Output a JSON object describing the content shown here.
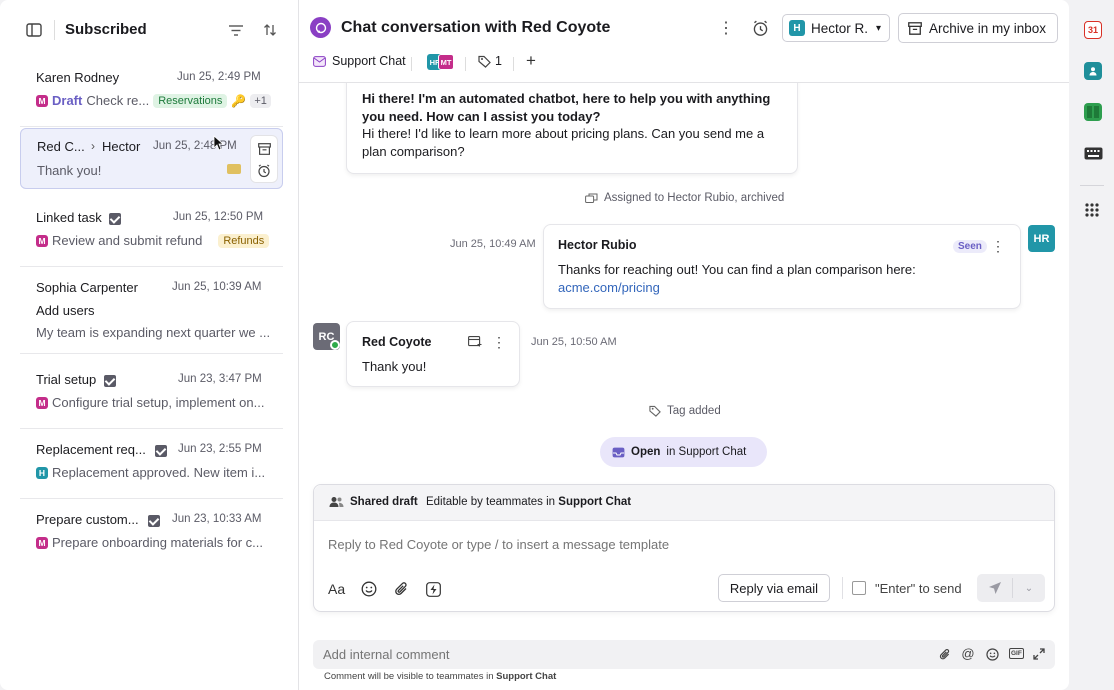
{
  "list": {
    "title": "Subscribed",
    "items": [
      {
        "name": "Karen Rodney",
        "date": "Jun 25, 2:49 PM",
        "badge": "M",
        "draft": "Draft",
        "preview": "Check re...",
        "tag": "Reservations",
        "extra": "+1"
      },
      {
        "name": "Red C...",
        "to": "Hector",
        "date": "Jun 25, 2:48 PM",
        "preview": "Thank you!"
      },
      {
        "name": "Linked task",
        "date": "Jun 25, 12:50 PM",
        "badge": "M",
        "preview": "Review and submit refund",
        "tag": "Refunds"
      },
      {
        "name": "Sophia Carpenter",
        "date": "Jun 25, 10:39 AM",
        "subject": "Add users",
        "preview": "My team is expanding next quarter we ..."
      },
      {
        "name": "Trial setup",
        "date": "Jun 23, 3:47 PM",
        "badge": "M",
        "preview": "Configure trial setup, implement on..."
      },
      {
        "name": "Replacement req...",
        "date": "Jun 23, 2:55 PM",
        "badge": "H",
        "preview": "Replacement approved. New item i..."
      },
      {
        "name": "Prepare custom...",
        "date": "Jun 23, 10:33 AM",
        "badge": "M",
        "preview": "Prepare onboarding materials for c..."
      }
    ]
  },
  "header": {
    "title": "Chat conversation with Red Coyote",
    "assignee_initial": "H",
    "assignee": "Hector R.",
    "archive": "Archive in my inbox",
    "inbox": "Support Chat",
    "avatars": [
      "HR",
      "MT"
    ],
    "tag_count": "1"
  },
  "feed": {
    "bot_bold": "Hi there! I'm an automated chatbot, here to help you with anything you need. How can I assist you today?",
    "bot_text": "Hi there! I'd like to learn more about pricing plans. Can you send me a plan comparison?",
    "assigned": "Assigned to Hector Rubio, archived",
    "hr_time": "Jun 25, 10:49 AM",
    "hr_name": "Hector Rubio",
    "seen": "Seen",
    "hr_text": "Thanks for reaching out! You can find a plan comparison here:",
    "hr_link": "acme.com/pricing",
    "hr_avatar": "HR",
    "rc_avatar": "RC",
    "rc_name": "Red Coyote",
    "rc_text": "Thank you!",
    "rc_time": "Jun 25, 10:50 AM",
    "tag_added": "Tag added",
    "open_bold": "Open",
    "open_rest": "in Support Chat"
  },
  "composer": {
    "shared": "Shared draft",
    "editable": "Editable by teammates in",
    "inbox": "Support Chat",
    "placeholder": "Reply to Red Coyote or type / to insert a message template",
    "font": "Aa",
    "reply_email": "Reply via email",
    "enter_send": "\"Enter\" to send"
  },
  "comment": {
    "placeholder": "Add internal comment",
    "note": "Comment will be visible to teammates in",
    "note_inbox": "Support Chat",
    "gif": "GIF"
  },
  "rail": {
    "calendar_day": "31"
  }
}
